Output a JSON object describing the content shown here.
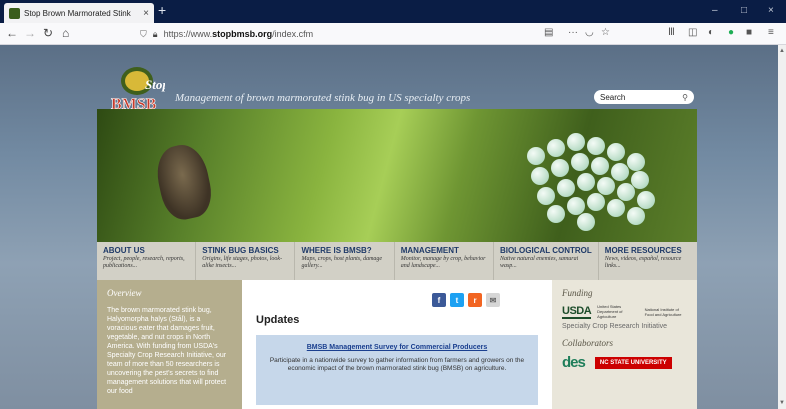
{
  "browser": {
    "tab_title": "Stop Brown Marmorated Stink",
    "tab_close": "×",
    "new_tab": "+",
    "url_prefix": "https://www.",
    "url_domain": "stopbmsb.org",
    "url_path": "/index.cfm",
    "window_controls": [
      "–",
      "□",
      "×"
    ]
  },
  "site": {
    "logo_word1": "Stop",
    "logo_word2": "BMSB",
    "tagline": "Management of brown marmorated stink bug in US specialty crops",
    "search_placeholder": "Search",
    "menu": [
      {
        "heading": "ABOUT US",
        "sub": "Project, people, research, reports, publications..."
      },
      {
        "heading": "STINK BUG BASICS",
        "sub": "Origins, life stages, photos, look-alike insects..."
      },
      {
        "heading": "WHERE IS BMSB?",
        "sub": "Maps, crops, host plants, damage gallery..."
      },
      {
        "heading": "MANAGEMENT",
        "sub": "Monitor, manage by crop, behavior and landscape..."
      },
      {
        "heading": "BIOLOGICAL CONTROL",
        "sub": "Native natural enemies, samurai wasp..."
      },
      {
        "heading": "MORE RESOURCES",
        "sub": "News, videos, español, resource links..."
      }
    ],
    "overview": {
      "title": "Overview",
      "text": "The brown marmorated stink bug, Halyomorpha halys (Stål), is a voracious eater that damages fruit, vegetable, and nut crops in North America. With funding from USDA's Specialty Crop Research Initiative, our team of more than 50 researchers is uncovering the pest's secrets to find management solutions that will protect our food"
    },
    "updates": {
      "title": "Updates",
      "link": "BMSB Management Survey for Commercial Producers",
      "text": "Participate in a nationwide survey to gather information from farmers and growers on the economic impact of the brown marmorated stink bug (BMSB) on agriculture."
    },
    "funding": {
      "title": "Funding",
      "usda": "USDA",
      "usda_line1": "United States Department of Agriculture",
      "usda_line2": "National Institute of Food and Agriculture",
      "scri": "Specialty Crop Research Initiative"
    },
    "collaborators": {
      "title": "Collaborators",
      "logo1": "des",
      "logo2": "NC STATE UNIVERSITY"
    },
    "social": {
      "facebook": "f",
      "twitter": "t",
      "rss": "r",
      "email": "✉"
    }
  },
  "colors": {
    "titlebar": "#0a1d45",
    "menu_heading": "#1f3a68",
    "notice_bg": "#c6d7ea",
    "facebook": "#3b5998",
    "twitter": "#1da1f2",
    "rss": "#f26522",
    "email": "#d6d6d6"
  }
}
